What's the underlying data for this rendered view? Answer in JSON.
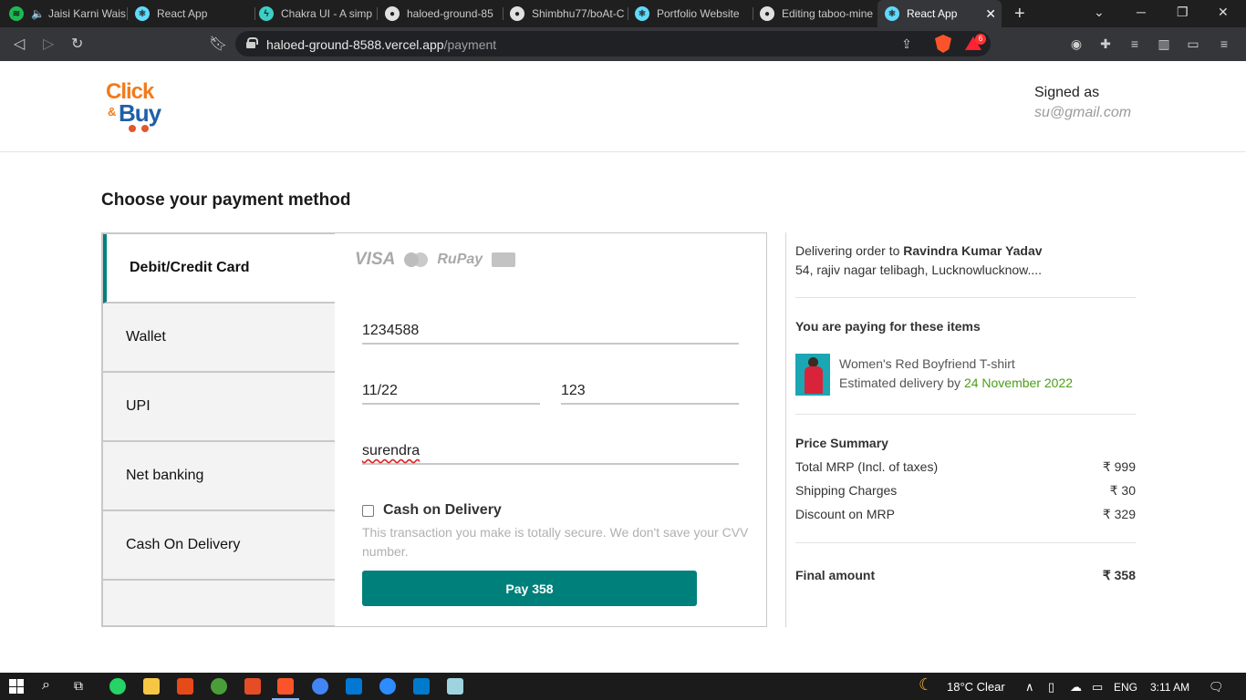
{
  "browser": {
    "tabs": [
      {
        "label": "Jaisi Karni Wais",
        "icon": "spotify-icon",
        "color": "#1db954"
      },
      {
        "label": "React App",
        "icon": "react-icon",
        "color": "#61dafb"
      },
      {
        "label": "Chakra UI - A simp",
        "icon": "chakra-icon",
        "color": "#3dcfc7"
      },
      {
        "label": "haloed-ground-85",
        "icon": "github-icon",
        "color": "#e0e0e0"
      },
      {
        "label": "Shimbhu77/boAt-C",
        "icon": "github-icon",
        "color": "#e0e0e0"
      },
      {
        "label": "Portfolio Website",
        "icon": "react-icon",
        "color": "#61dafb"
      },
      {
        "label": "Editing taboo-mine",
        "icon": "github-icon",
        "color": "#e0e0e0"
      },
      {
        "label": "React App",
        "icon": "react-icon",
        "color": "#61dafb"
      }
    ],
    "url_host": "haloed-ground-8588.vercel.app",
    "url_path": "/payment",
    "notification_count": "6"
  },
  "header": {
    "logo_click": "Click",
    "logo_amp": "&",
    "logo_buy": "Buy",
    "signed_label": "Signed as",
    "email": "su@gmail.com"
  },
  "page_title": "Choose your payment method",
  "methods": [
    "Debit/Credit Card",
    "Wallet",
    "UPI",
    "Net banking",
    "Cash On Delivery"
  ],
  "card": {
    "brands": {
      "visa": "VISA",
      "rupay": "RuPay"
    },
    "card_number": "1234588",
    "expiry": "11/22",
    "cvv": "123",
    "name": "surendra",
    "cod_label": "Cash on Delivery",
    "secure_note": "This transaction you make is totally secure. We don't save your CVV number.",
    "pay_button": "Pay 358"
  },
  "summary": {
    "delivering_prefix": "Delivering order to",
    "recipient": "Ravindra Kumar Yadav",
    "address": "54, rajiv nagar telibagh, Lucknowlucknow....",
    "items_heading": "You are paying for these items",
    "item_name": "Women's Red Boyfriend T-shirt",
    "estimated_prefix": "Estimated delivery by",
    "estimated_date": "24 November 2022",
    "price_heading": "Price Summary",
    "rows": [
      {
        "label": "Total MRP (Incl. of taxes)",
        "value": "₹ 999"
      },
      {
        "label": "Shipping Charges",
        "value": "₹ 30"
      },
      {
        "label": "Discount on MRP",
        "value": "₹ 329"
      }
    ],
    "final_label": "Final amount",
    "final_value": "₹ 358"
  },
  "taskbar": {
    "weather": "18°C  Clear",
    "language": "ENG",
    "time": "3:11 AM"
  },
  "colors": {
    "accent": "#00807a",
    "logo_orange": "#f07c1d",
    "logo_blue": "#1f5fa8",
    "date_green": "#4a9e16"
  }
}
